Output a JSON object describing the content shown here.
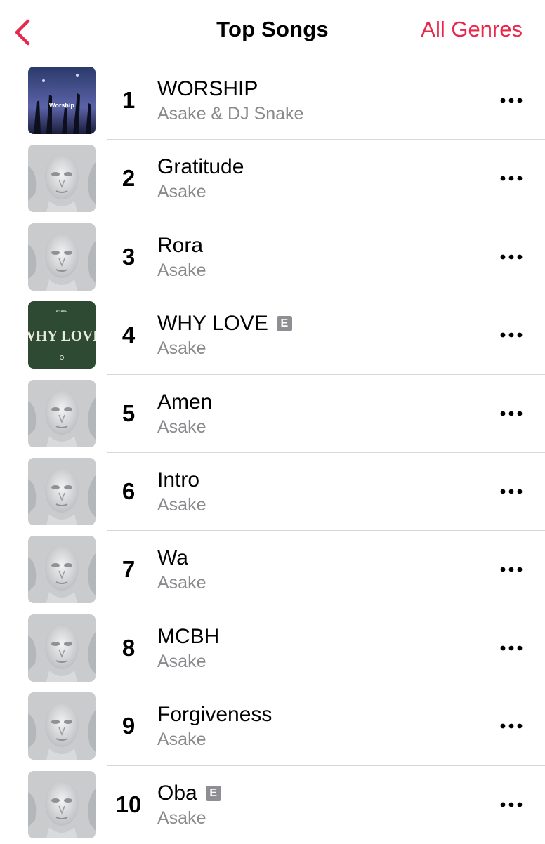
{
  "nav": {
    "title": "Top Songs",
    "right_label": "All Genres",
    "back_icon": "chevron-left-icon",
    "accent": "#e8284a"
  },
  "songs": [
    {
      "rank": "1",
      "title": "WORSHIP",
      "artist": "Asake & DJ Snake",
      "explicit": false,
      "art": "worship"
    },
    {
      "rank": "2",
      "title": "Gratitude",
      "artist": "Asake",
      "explicit": false,
      "art": "face"
    },
    {
      "rank": "3",
      "title": "Rora",
      "artist": "Asake",
      "explicit": false,
      "art": "face"
    },
    {
      "rank": "4",
      "title": "WHY LOVE",
      "artist": "Asake",
      "explicit": true,
      "explicit_label": "E",
      "art": "whylove"
    },
    {
      "rank": "5",
      "title": "Amen",
      "artist": "Asake",
      "explicit": false,
      "art": "face"
    },
    {
      "rank": "6",
      "title": "Intro",
      "artist": "Asake",
      "explicit": false,
      "art": "face"
    },
    {
      "rank": "7",
      "title": "Wa",
      "artist": "Asake",
      "explicit": false,
      "art": "face"
    },
    {
      "rank": "8",
      "title": "MCBH",
      "artist": "Asake",
      "explicit": false,
      "art": "face"
    },
    {
      "rank": "9",
      "title": "Forgiveness",
      "artist": "Asake",
      "explicit": false,
      "art": "face"
    },
    {
      "rank": "10",
      "title": "Oba",
      "artist": "Asake",
      "explicit": true,
      "explicit_label": "E",
      "art": "face"
    }
  ],
  "artwork_text": {
    "whylove_brand": "ASAKE",
    "whylove_title": "WHY LOVE",
    "worship_small": "Worship"
  },
  "colors": {
    "secondary_text": "#8a8a8e",
    "separator": "#d7d7da",
    "explicit_badge": "#8e8e93",
    "whylove_bg": "#2e4a33"
  }
}
